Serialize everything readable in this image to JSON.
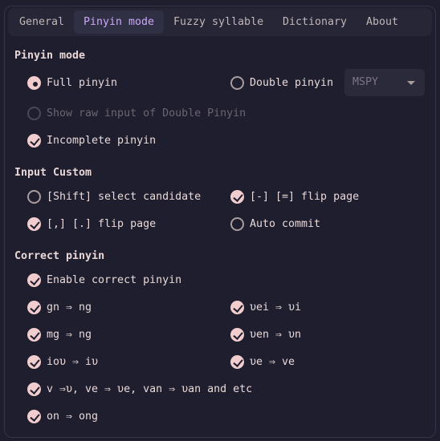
{
  "tabs": [
    {
      "label": "General",
      "active": false
    },
    {
      "label": "Pinyin mode",
      "active": true
    },
    {
      "label": "Fuzzy syllable",
      "active": false
    },
    {
      "label": "Dictionary",
      "active": false
    },
    {
      "label": "About",
      "active": false
    }
  ],
  "pinyin_mode": {
    "title": "Pinyin mode",
    "full_pinyin": {
      "label": "Full pinyin",
      "checked": true
    },
    "double_pinyin": {
      "label": "Double pinyin",
      "checked": false
    },
    "double_scheme": {
      "value": "MSPY",
      "enabled": false
    },
    "show_raw": {
      "label": "Show raw input of Double Pinyin",
      "checked": false,
      "enabled": false
    },
    "incomplete": {
      "label": "Incomplete pinyin",
      "checked": true
    }
  },
  "input_custom": {
    "title": "Input Custom",
    "shift_select": {
      "label": "[Shift] select candidate",
      "checked": false
    },
    "minus_equal_flip": {
      "label": "[-] [=] flip page",
      "checked": true
    },
    "comma_period_flip": {
      "label": "[,] [.] flip page",
      "checked": true
    },
    "auto_commit": {
      "label": "Auto commit",
      "checked": false
    }
  },
  "correct_pinyin": {
    "title": "Correct pinyin",
    "enable": {
      "label": "Enable correct pinyin",
      "checked": true
    },
    "gn_ng": {
      "label": "gn ⇒ ng",
      "checked": true
    },
    "uei_ui": {
      "label": "υei ⇒ υi",
      "checked": true
    },
    "mg_ng": {
      "label": "mg ⇒ ng",
      "checked": true
    },
    "uen_un": {
      "label": "υen ⇒ υn",
      "checked": true
    },
    "iou_iu": {
      "label": "ioυ ⇒ iυ",
      "checked": true
    },
    "ue_ve": {
      "label": "υe ⇒ ve",
      "checked": true
    },
    "v_u": {
      "label": "v ⇒υ, ve ⇒ υe, van ⇒ υan and etc",
      "checked": true
    },
    "on_ong": {
      "label": "on ⇒ ong",
      "checked": true
    }
  },
  "colors": {
    "background": "#1e1e2e",
    "accent": "#f2cdcd",
    "active_tab": "#cba6f7"
  }
}
